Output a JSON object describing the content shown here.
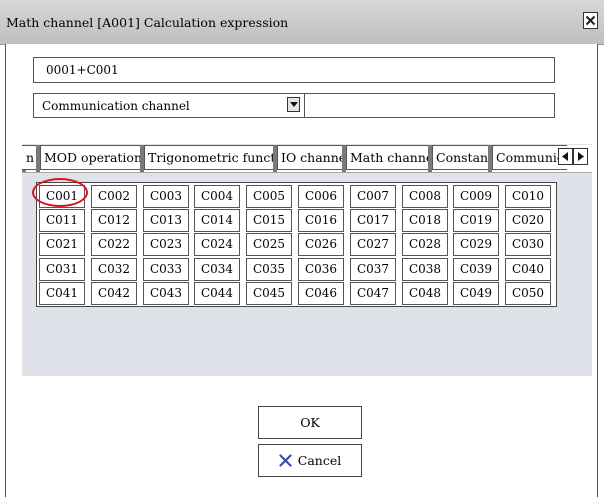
{
  "window": {
    "title": "Math channel [A001] Calculation expression"
  },
  "expression": {
    "value": "0001+C001"
  },
  "category": {
    "selected": "Communication channel"
  },
  "tabs": [
    {
      "label": "n"
    },
    {
      "label": "MOD operation"
    },
    {
      "label": "Trigonometric function"
    },
    {
      "label": "IO channel"
    },
    {
      "label": "Math channel"
    },
    {
      "label": "Constant"
    },
    {
      "label": "Communica"
    }
  ],
  "channels": [
    [
      "C001",
      "C002",
      "C003",
      "C004",
      "C005",
      "C006",
      "C007",
      "C008",
      "C009",
      "C010"
    ],
    [
      "C011",
      "C012",
      "C013",
      "C014",
      "C015",
      "C016",
      "C017",
      "C018",
      "C019",
      "C020"
    ],
    [
      "C021",
      "C022",
      "C023",
      "C024",
      "C025",
      "C026",
      "C027",
      "C028",
      "C029",
      "C030"
    ],
    [
      "C031",
      "C032",
      "C033",
      "C034",
      "C035",
      "C036",
      "C037",
      "C038",
      "C039",
      "C040"
    ],
    [
      "C041",
      "C042",
      "C043",
      "C044",
      "C045",
      "C046",
      "C047",
      "C048",
      "C049",
      "C050"
    ]
  ],
  "buttons": {
    "ok": "OK",
    "cancel": "Cancel"
  },
  "icons": {
    "close": "close-icon",
    "dropdown": "chevron-down-icon",
    "scroll_left": "arrow-left-icon",
    "scroll_right": "arrow-right-icon",
    "cancel": "x-icon"
  },
  "colors": {
    "highlight": "#d8141b",
    "panel": "#dfe2e9",
    "cancel_x": "#3b4ea6"
  }
}
